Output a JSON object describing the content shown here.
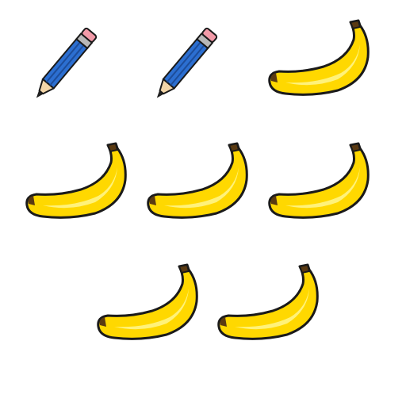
{
  "scene": {
    "items": [
      {
        "icon": "pencil-icon"
      },
      {
        "icon": "pencil-icon"
      },
      {
        "icon": "banana-icon"
      },
      {
        "icon": "banana-icon"
      },
      {
        "icon": "banana-icon"
      },
      {
        "icon": "banana-icon"
      },
      {
        "icon": "banana-icon"
      },
      {
        "icon": "banana-icon"
      }
    ],
    "colors": {
      "background": "#ffffff",
      "outline": "#1a1a1a",
      "banana_yellow": "#ffd800",
      "banana_highlight": "#fff27a",
      "banana_stem": "#5a3a12",
      "pencil_blue": "#2c6fd1",
      "pencil_blue_dark": "#1d4d9a",
      "pencil_eraser": "#f29aa8",
      "pencil_ferrule": "#b8b8b8",
      "pencil_wood": "#f3d6a8",
      "pencil_lead": "#222222"
    }
  }
}
